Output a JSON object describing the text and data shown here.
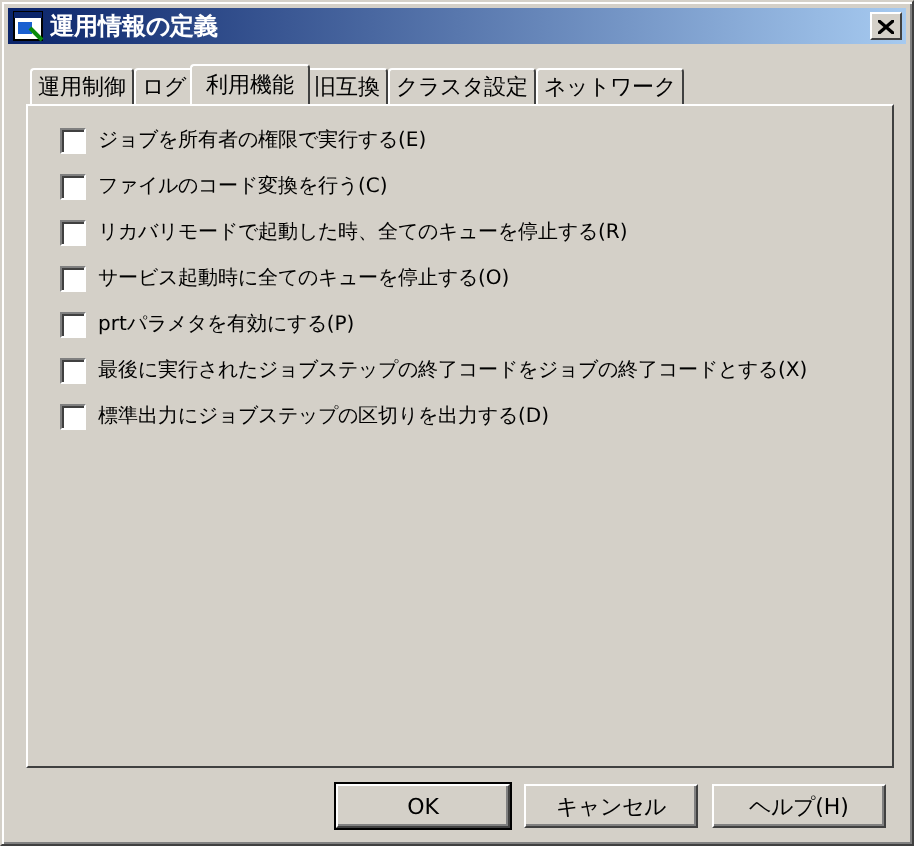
{
  "window": {
    "title": "運用情報の定義"
  },
  "tabs": [
    {
      "label": "運用制御",
      "selected": false
    },
    {
      "label": "ログ",
      "selected": false
    },
    {
      "label": "利用機能",
      "selected": true
    },
    {
      "label": "旧互換",
      "selected": false
    },
    {
      "label": "クラスタ設定",
      "selected": false
    },
    {
      "label": "ネットワーク",
      "selected": false
    }
  ],
  "options": [
    {
      "label": "ジョブを所有者の権限で実行する(E)",
      "checked": false
    },
    {
      "label": "ファイルのコード変換を行う(C)",
      "checked": false
    },
    {
      "label": "リカバリモードで起動した時、全てのキューを停止する(R)",
      "checked": false
    },
    {
      "label": "サービス起動時に全てのキューを停止する(O)",
      "checked": false
    },
    {
      "label": "prtパラメタを有効にする(P)",
      "checked": false
    },
    {
      "label": "最後に実行されたジョブステップの終了コードをジョブの終了コードとする(X)",
      "checked": false
    },
    {
      "label": "標準出力にジョブステップの区切りを出力する(D)",
      "checked": false
    }
  ],
  "buttons": [
    {
      "label": "OK",
      "default": true
    },
    {
      "label": "キャンセル",
      "default": false
    },
    {
      "label": "ヘルプ(H)",
      "default": false
    }
  ]
}
